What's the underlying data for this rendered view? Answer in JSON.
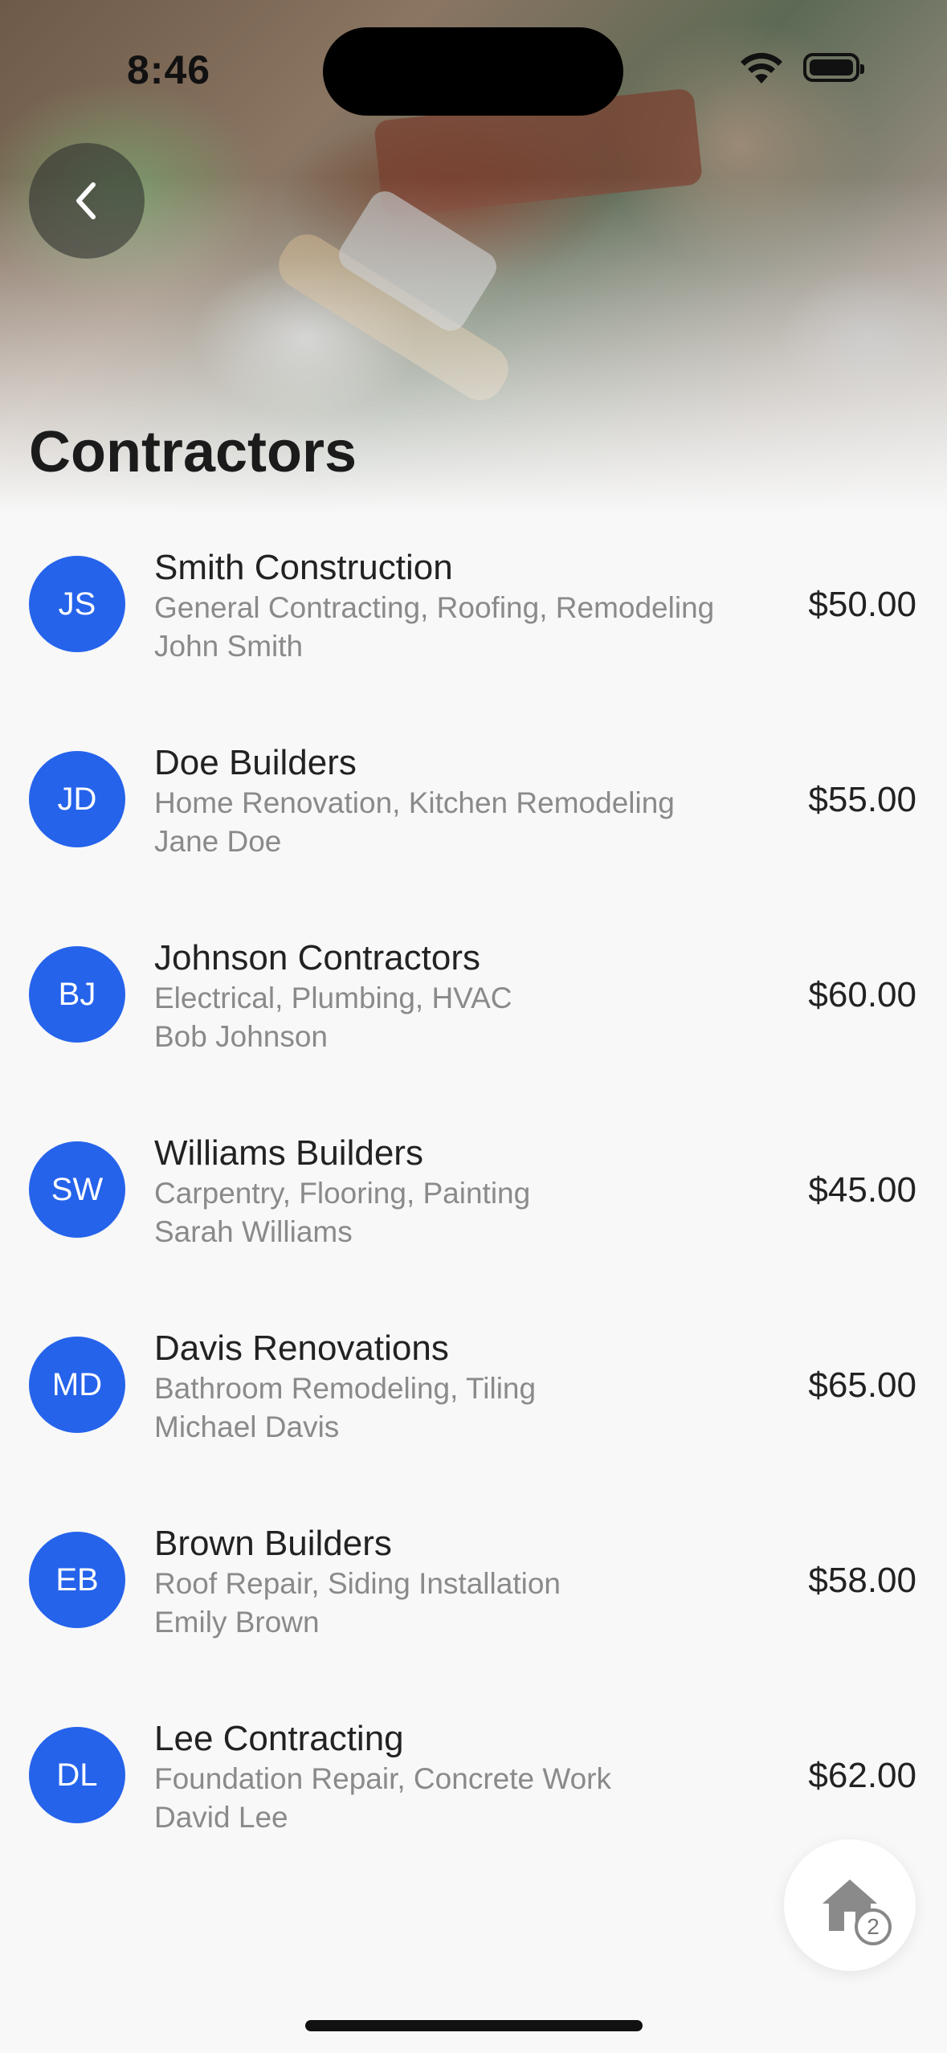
{
  "status_bar": {
    "time": "8:46"
  },
  "header": {
    "title": "Contractors",
    "back_label": "Back"
  },
  "contractors": [
    {
      "initials": "JS",
      "company": "Smith Construction",
      "services": "General Contracting, Roofing, Remodeling",
      "contact": "John Smith",
      "rate": "$50.00"
    },
    {
      "initials": "JD",
      "company": "Doe Builders",
      "services": "Home Renovation, Kitchen Remodeling",
      "contact": "Jane Doe",
      "rate": "$55.00"
    },
    {
      "initials": "BJ",
      "company": "Johnson Contractors",
      "services": "Electrical, Plumbing, HVAC",
      "contact": "Bob Johnson",
      "rate": "$60.00"
    },
    {
      "initials": "SW",
      "company": "Williams Builders",
      "services": "Carpentry, Flooring, Painting",
      "contact": "Sarah Williams",
      "rate": "$45.00"
    },
    {
      "initials": "MD",
      "company": "Davis Renovations",
      "services": "Bathroom Remodeling, Tiling",
      "contact": "Michael Davis",
      "rate": "$65.00"
    },
    {
      "initials": "EB",
      "company": "Brown Builders",
      "services": "Roof Repair, Siding Installation",
      "contact": "Emily Brown",
      "rate": "$58.00"
    },
    {
      "initials": "DL",
      "company": "Lee Contracting",
      "services": "Foundation Repair, Concrete Work",
      "contact": "David Lee",
      "rate": "$62.00"
    }
  ],
  "fab": {
    "icon": "home-icon",
    "badge_count": "2"
  },
  "colors": {
    "avatar_bg": "#2563eb",
    "background": "#f8f8f8",
    "secondary_text": "#8a8a8a"
  }
}
